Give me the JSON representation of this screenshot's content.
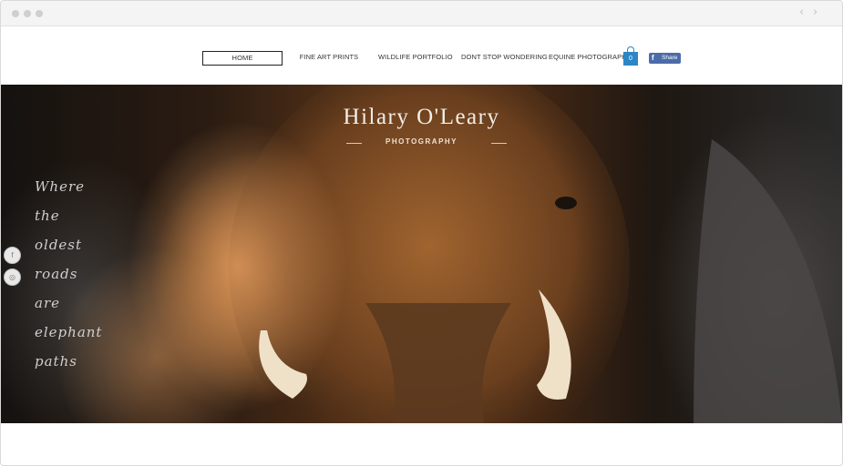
{
  "nav": {
    "items": [
      {
        "label": "HOME",
        "active": true
      },
      {
        "label": "FINE ART PRINTS",
        "active": false
      },
      {
        "label": "WILDLIFE PORTFOLIO",
        "active": false
      },
      {
        "label": "DONT STOP WONDERING",
        "active": false
      },
      {
        "label": "EQUINE PHOTOGRAPHY",
        "active": false
      }
    ]
  },
  "cart": {
    "count": "0",
    "icon": "shopping-bag-icon",
    "color": "#2b86c5"
  },
  "share": {
    "label": "Share",
    "icon": "facebook-icon",
    "color": "#4b6ca9"
  },
  "hero": {
    "title": "Hilary O'Leary",
    "subtitle": "PHOTOGRAPHY",
    "quote": [
      "Where",
      "the",
      "oldest",
      "roads",
      "are",
      "elephant",
      "paths"
    ]
  },
  "social": [
    {
      "icon": "facebook-icon",
      "glyph": "f"
    },
    {
      "icon": "instagram-icon",
      "glyph": "◎"
    }
  ]
}
